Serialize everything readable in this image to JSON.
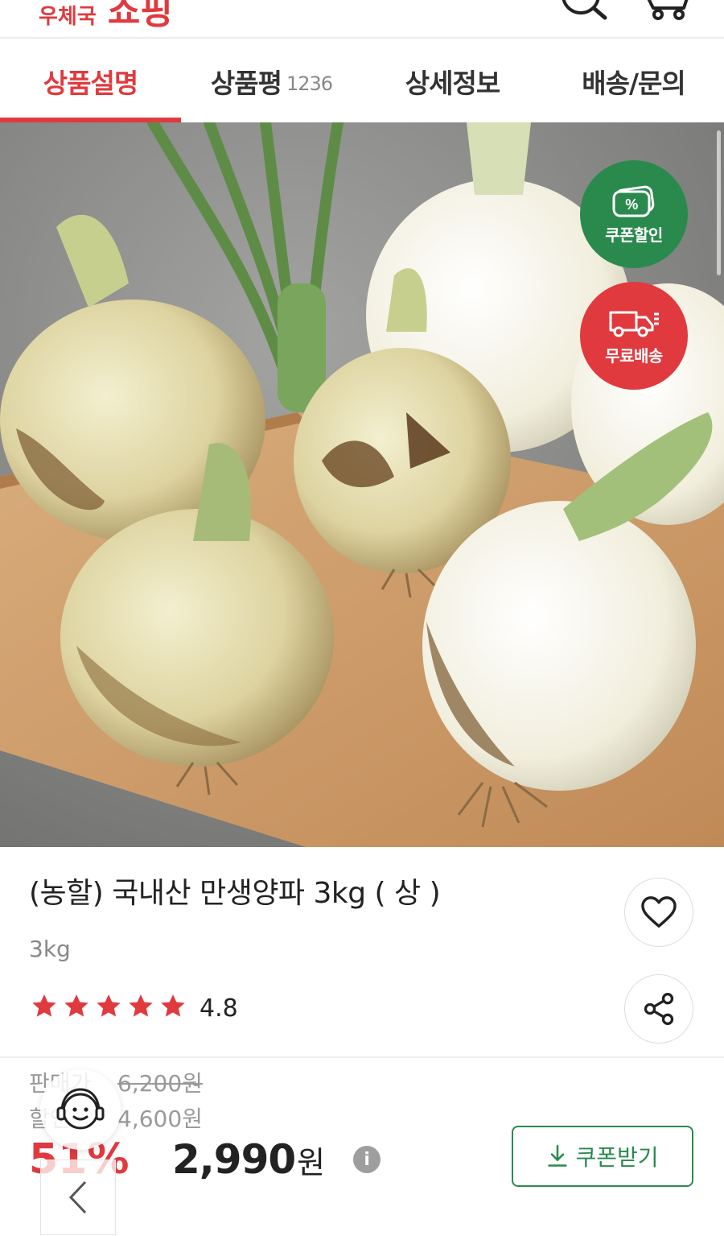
{
  "header": {
    "brand_sub": "우체국",
    "brand_main": "쇼핑",
    "icons": [
      "search-icon",
      "cart-icon"
    ]
  },
  "tabs": [
    {
      "label": "상품설명",
      "count": "",
      "active": true
    },
    {
      "label": "상품평",
      "count": "1236",
      "active": false
    },
    {
      "label": "상세정보",
      "count": "",
      "active": false
    },
    {
      "label": "배송/문의",
      "count": "",
      "active": false
    }
  ],
  "badges": {
    "coupon": {
      "label": "쿠폰할인",
      "icon": "coupon-icon"
    },
    "shipping": {
      "label": "무료배송",
      "icon": "truck-icon"
    }
  },
  "product": {
    "title": "(농할) 국내산 만생양파 3kg ( 상 )",
    "option": "3kg",
    "rating": "4.8",
    "stars": 5
  },
  "price": {
    "sale_label": "판매가",
    "sale_value": "6,200원",
    "discount_label": "할인가",
    "discount_value": "4,600원",
    "rate": "51%",
    "final": "2,990",
    "final_unit": "원",
    "info_icon": "i"
  },
  "coupon_button": {
    "label": "쿠폰받기",
    "icon": "download-icon"
  },
  "colors": {
    "accent": "#e03a3e",
    "green": "#2a8a4e",
    "muted": "#888888"
  }
}
